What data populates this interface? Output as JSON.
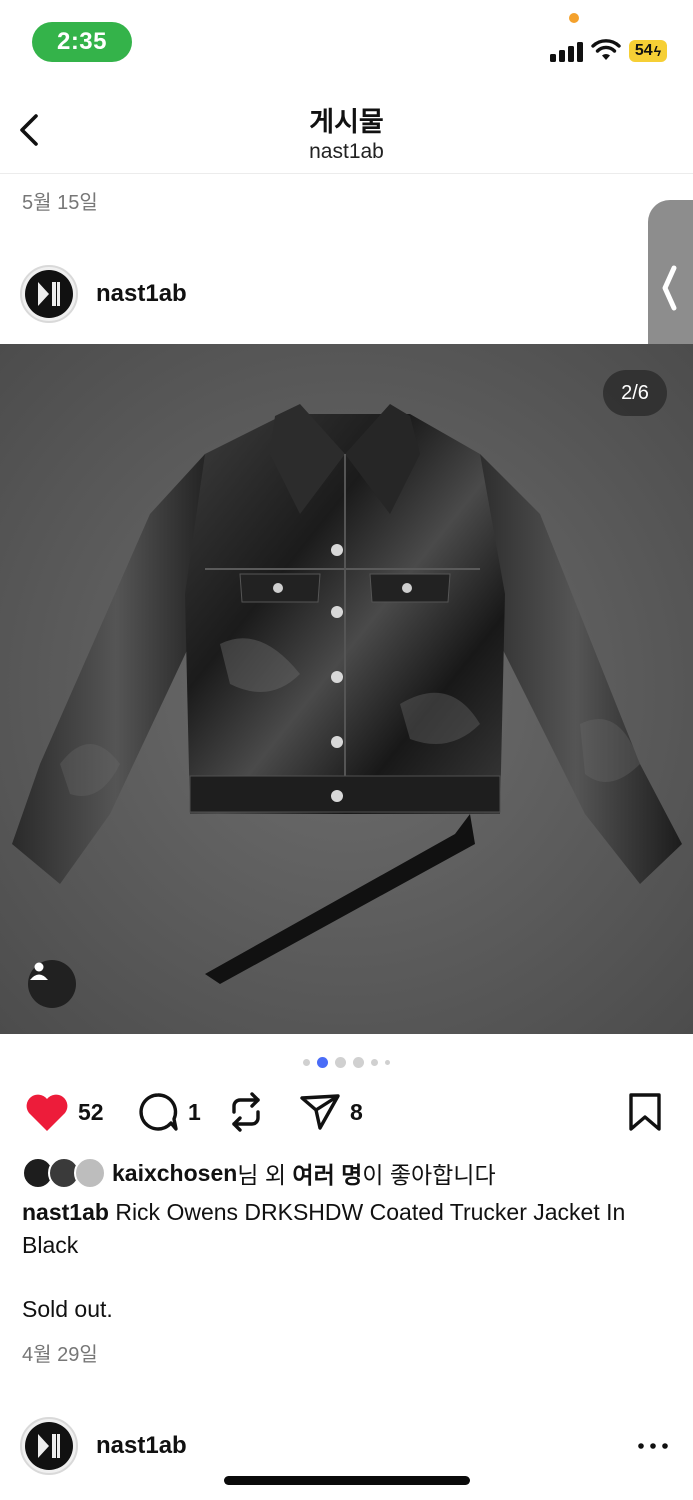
{
  "status_bar": {
    "time": "2:35",
    "battery": "54",
    "icons": [
      "cellular-signal-icon",
      "wifi-icon",
      "battery-charging-icon"
    ],
    "colors": {
      "time_pill": "#34b34a",
      "battery": "#f6cf35"
    }
  },
  "header": {
    "title": "게시물",
    "subtitle": "nast1ab",
    "back_icon": "chevron-left-icon"
  },
  "previous_post_date": "5월 15일",
  "post": {
    "username": "nast1ab",
    "image_counter": "2/6",
    "image_subject": "black coated trucker jacket on gray carpet",
    "carousel": {
      "count": 6,
      "active_index": 1
    },
    "actions": {
      "likes": "52",
      "comments": "1",
      "reposts_label": "",
      "shares": "8"
    },
    "liked_by": {
      "user": "kaixchosen",
      "suffix_1": "님 외 ",
      "others": "여러 명",
      "suffix_2": "이 좋아합니다"
    },
    "caption": {
      "author": "nast1ab",
      "text": " Rick Owens DRKSHDW Coated Trucker Jacket In Black",
      "extra": "Sold out."
    },
    "date": "4월 29일"
  },
  "next_post": {
    "username": "nast1ab"
  },
  "colors": {
    "heart": "#ed1c3a",
    "active_dot": "#4a6cf7"
  }
}
